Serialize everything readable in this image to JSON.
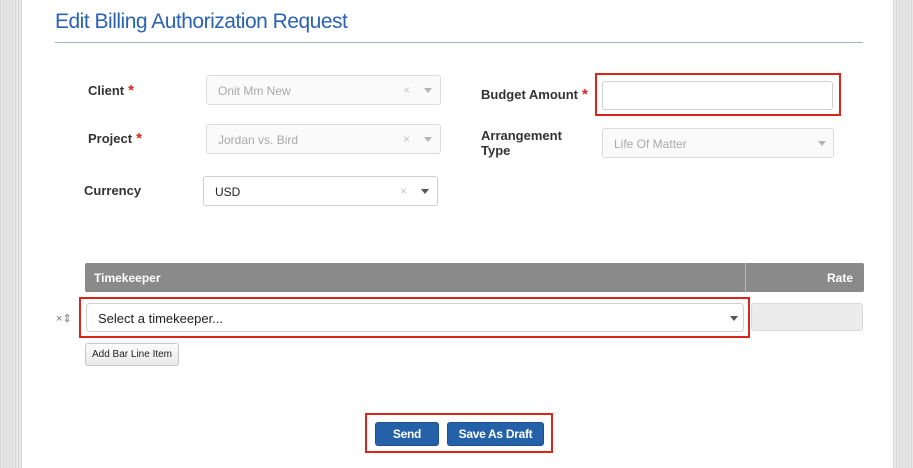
{
  "page": {
    "title": "Edit Billing Authorization Request"
  },
  "form": {
    "client": {
      "label": "Client",
      "required_mark": "*",
      "value": "Onit Mm New"
    },
    "project": {
      "label": "Project",
      "required_mark": "*",
      "value": "Jordan vs. Bird"
    },
    "currency": {
      "label": "Currency",
      "value": "USD"
    },
    "budget_amount": {
      "label": "Budget Amount",
      "required_mark": "*",
      "value": ""
    },
    "arrangement_type": {
      "label_line1": "Arrangement",
      "label_line2": "Type",
      "value": "Life Of Matter"
    },
    "clear_glyph": "×"
  },
  "timekeeper_table": {
    "columns": [
      "Timekeeper",
      "Rate"
    ],
    "row": {
      "remove_glyph": "×",
      "reorder_glyph": "⇕",
      "placeholder": "Select a timekeeper..."
    },
    "add_label": "Add Bar Line Item"
  },
  "actions": {
    "send_label": "Send",
    "save_draft_label": "Save As Draft"
  },
  "colors": {
    "accent": "#2b63b3",
    "button": "#2461a8",
    "highlight": "#d9261c",
    "required": "#d9261c"
  }
}
